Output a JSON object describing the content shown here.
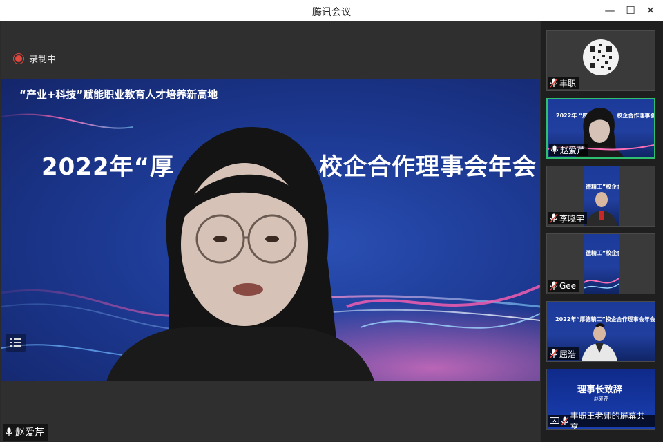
{
  "window": {
    "title": "腾讯会议",
    "minimize_glyph": "—",
    "maximize_glyph": "☐",
    "close_glyph": "✕"
  },
  "recording": {
    "label": "录制中",
    "dot_color": "#e2483d"
  },
  "main_share": {
    "slide_subtitle": "“产业+科技”赋能职业教育人才培养新高地",
    "slide_title": "2022年“厚",
    "slide_title_tail": "校企合作理事会年会"
  },
  "speaker": {
    "name": "赵爱芹",
    "icon": "microphone-icon"
  },
  "participants": [
    {
      "name": "丰职",
      "icon": "microphone-muted-icon",
      "media": "qr-code"
    },
    {
      "name": "赵爱芹",
      "icon": "microphone-muted-icon",
      "active": true,
      "slide_title": "2022年 “厚",
      "slide_tail": "校企合作理事会年会"
    },
    {
      "name": "李晓宇",
      "icon": "microphone-muted-icon",
      "slide_title": "德精工”校企合"
    },
    {
      "name": "Gee",
      "icon": "microphone-muted-icon",
      "slide_title": "德精工”校企合"
    },
    {
      "name": "屈浩",
      "icon": "microphone-muted-icon",
      "slide_title": "2022年“厚德精工”校企合作理事会年会"
    },
    {
      "name": "丰职王老师的屏幕共享",
      "icon": "microphone-muted-icon",
      "slide_title": "理事长致辞",
      "slide_sub": "赵爱芹"
    }
  ],
  "colors": {
    "active_border": "#2fbf71",
    "slide_blue": "#1d3a94"
  }
}
